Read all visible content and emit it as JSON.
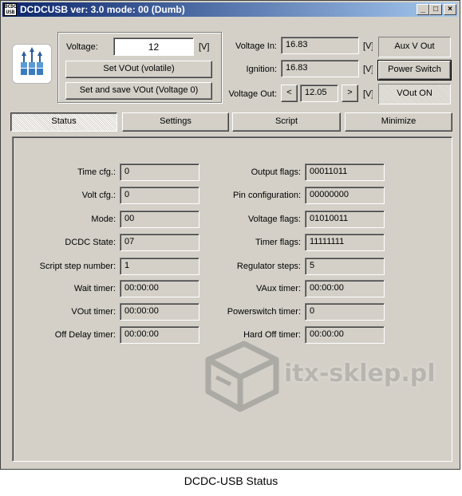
{
  "window": {
    "title": "DCDCUSB ver: 3.0 mode: 00 (Dumb)",
    "app_icon_text": "DCDC USB",
    "controls": {
      "minimize": "_",
      "maximize": "□",
      "close": "×"
    }
  },
  "voltage_set": {
    "label": "Voltage:",
    "value": "12",
    "unit": "[V]",
    "set_volatile_label": "Set VOut (volatile)",
    "set_save_label": "Set and save VOut (Voltage 0)"
  },
  "readouts": {
    "voltage_in_label": "Voltage In:",
    "voltage_in_value": "16.83",
    "voltage_in_unit": "[V]",
    "ignition_label": "Ignition:",
    "ignition_value": "16.83",
    "ignition_unit": "[V]",
    "voltage_out_label": "Voltage Out:",
    "voltage_out_value": "12.05",
    "voltage_out_unit": "[V]",
    "decrease_label": "<",
    "increase_label": ">"
  },
  "indicators": {
    "aux_vout": "Aux V Out",
    "power_switch": "Power Switch",
    "vout_on": "VOut ON"
  },
  "tabs": [
    {
      "label": "Status",
      "active": true
    },
    {
      "label": "Settings",
      "active": false
    },
    {
      "label": "Script",
      "active": false
    },
    {
      "label": "Minimize",
      "active": false
    }
  ],
  "status_left": [
    {
      "label": "Time cfg.:",
      "value": "0"
    },
    {
      "label": "Volt cfg.:",
      "value": "0"
    },
    {
      "label": "Mode:",
      "value": "00"
    },
    {
      "label": "DCDC State:",
      "value": "07"
    },
    {
      "label": "Script step number:",
      "value": "1"
    },
    {
      "label": "Wait timer:",
      "value": "00:00:00"
    },
    {
      "label": "VOut timer:",
      "value": "00:00:00"
    },
    {
      "label": "Off Delay timer:",
      "value": "00:00:00"
    }
  ],
  "status_right": [
    {
      "label": "Output flags:",
      "value": "00011011"
    },
    {
      "label": "Pin configuration:",
      "value": "00000000"
    },
    {
      "label": "Voltage flags:",
      "value": "01010011"
    },
    {
      "label": "Timer flags:",
      "value": "11111111"
    },
    {
      "label": "Regulator steps:",
      "value": "5"
    },
    {
      "label": "VAux timer:",
      "value": "00:00:00"
    },
    {
      "label": "Powerswitch timer:",
      "value": "0"
    },
    {
      "label": "Hard Off timer:",
      "value": "00:00:00"
    }
  ],
  "watermark": {
    "text": "itx-sklep.pl",
    "icon": "box-icon"
  },
  "caption": "DCDC-USB Status",
  "colors": {
    "titlebar_start": "#0a246a",
    "titlebar_end": "#a6caf0",
    "face": "#d4d0c8"
  }
}
